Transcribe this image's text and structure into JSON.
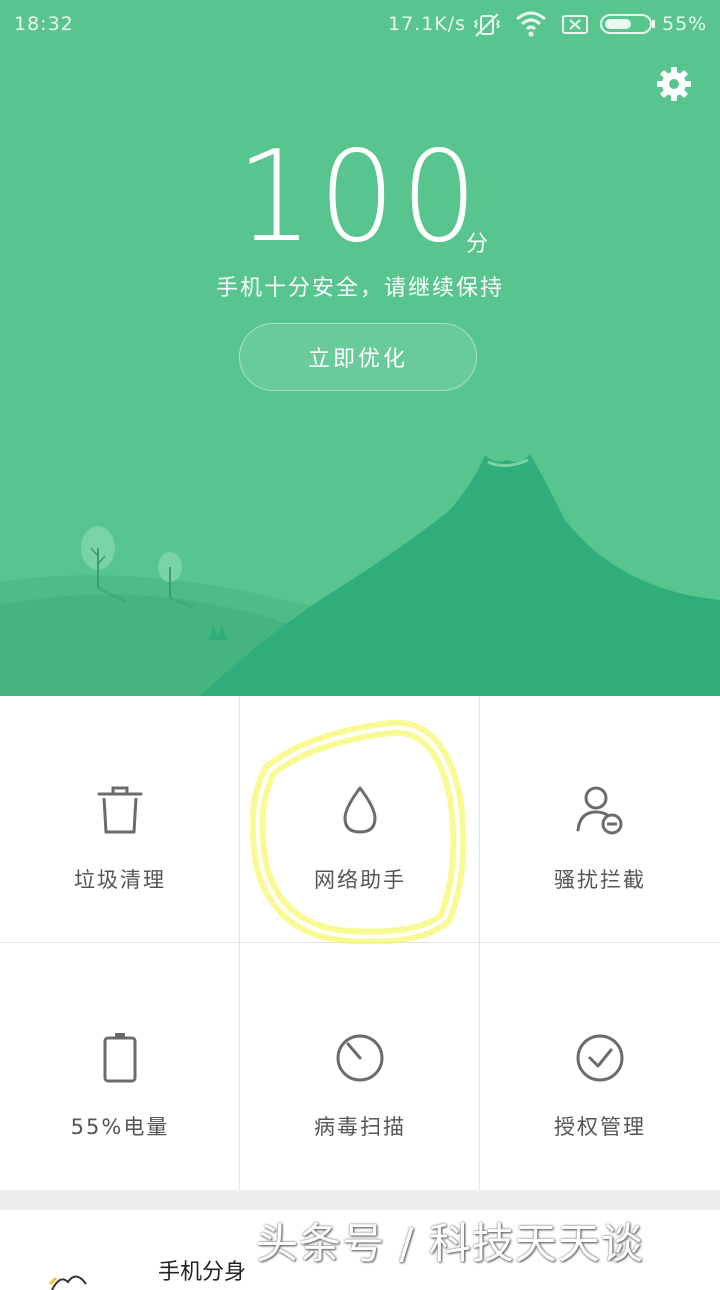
{
  "status_bar": {
    "time": "18:32",
    "net_speed": "17.1K/s",
    "battery_percent": "55%",
    "icons": [
      "vibrate-off-icon",
      "wifi-icon",
      "no-sim-icon",
      "battery-icon"
    ]
  },
  "header": {
    "settings_icon": "gear-icon",
    "score": "100",
    "score_unit": "分",
    "status_text": "手机十分安全，请继续保持",
    "optimize_label": "立即优化"
  },
  "tools": [
    {
      "label": "垃圾清理",
      "icon": "trash-icon"
    },
    {
      "label": "网络助手",
      "icon": "droplet-icon"
    },
    {
      "label": "骚扰拦截",
      "icon": "user-block-icon"
    },
    {
      "label": "55%电量",
      "icon": "battery-icon"
    },
    {
      "label": "病毒扫描",
      "icon": "scan-icon"
    },
    {
      "label": "授权管理",
      "icon": "check-circle-icon"
    }
  ],
  "bottom_card": {
    "title": "手机分身"
  },
  "watermark": "头条号 / 科技天天谈",
  "colors": {
    "hero_green": "#58c58f",
    "hill_dark": "#2fae7c",
    "icon_gray": "#6b6b6b",
    "highlight": "#f4f53a"
  }
}
